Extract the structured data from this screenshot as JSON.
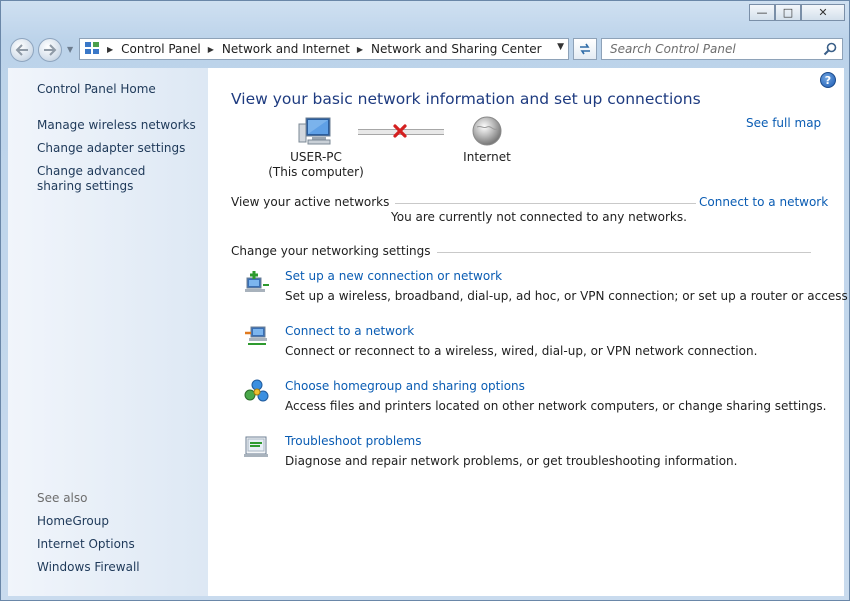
{
  "window": {
    "minimize_glyph": "—",
    "maximize_glyph": "□",
    "close_glyph": "✕"
  },
  "nav": {
    "back_icon": "back-arrow-icon",
    "forward_icon": "forward-arrow-icon",
    "breadcrumbs": [
      "Control Panel",
      "Network and Internet",
      "Network and Sharing Center"
    ],
    "search_placeholder": "Search Control Panel"
  },
  "sidebar": {
    "home": "Control Panel Home",
    "links": [
      {
        "label": "Manage wireless networks"
      },
      {
        "label": "Change adapter settings"
      },
      {
        "label": "Change advanced sharing settings"
      }
    ],
    "see_also_label": "See also",
    "see_also": [
      {
        "label": "HomeGroup"
      },
      {
        "label": "Internet Options"
      },
      {
        "label": "Windows Firewall"
      }
    ]
  },
  "main": {
    "heading": "View your basic network information and set up connections",
    "see_full_map": "See full map",
    "computer_name": "USER-PC",
    "computer_sub": "(This computer)",
    "internet_label": "Internet",
    "active_networks_title": "View your active networks",
    "connect_link": "Connect to a network",
    "not_connected_text": "You are currently not connected to any networks.",
    "change_settings_title": "Change your networking settings",
    "tasks": [
      {
        "link": "Set up a new connection or network",
        "desc": "Set up a wireless, broadband, dial-up, ad hoc, or VPN connection; or set up a router or access point.",
        "icon": "new-connection-icon"
      },
      {
        "link": "Connect to a network",
        "desc": "Connect or reconnect to a wireless, wired, dial-up, or VPN network connection.",
        "icon": "connect-network-icon"
      },
      {
        "link": "Choose homegroup and sharing options",
        "desc": "Access files and printers located on other network computers, or change sharing settings.",
        "icon": "homegroup-icon"
      },
      {
        "link": "Troubleshoot problems",
        "desc": "Diagnose and repair network problems, or get troubleshooting information.",
        "icon": "troubleshoot-icon"
      }
    ]
  },
  "colors": {
    "link": "#0a5cb3",
    "heading": "#1e3b80",
    "error_x": "#d42020"
  }
}
